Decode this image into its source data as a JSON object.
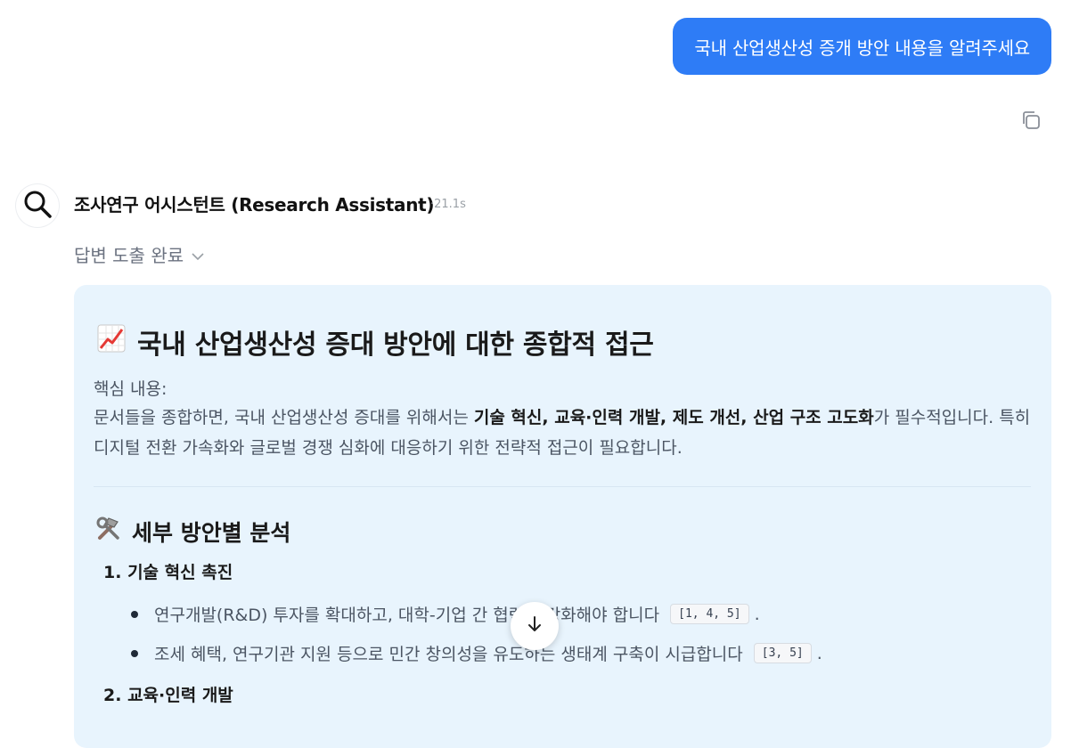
{
  "user_message": "국내 산업생산성 증개 방안 내용을 알려주세요",
  "assistant": {
    "name": "조사연구 어시스턴트 (Research Assistant)",
    "elapsed": "·21.1s",
    "status": "답변 도출 완료",
    "status_chevron": "chevron-down-icon"
  },
  "answer": {
    "title": "국내 산업생산성 증대 방안에 대한 종합적 접근",
    "title_icon": "chart-increasing-icon",
    "summary_label": "핵심 내용:",
    "summary_lines": {
      "pre": "문서들을 종합하면, 국내 산업생산성 증대를 위해서는 ",
      "bold": "기술 혁신, 교육·인력 개발, 제도 개선, 산업 구조 고도화",
      "post": "가 필수적입니다. 특히 디지털 전환 가속화와 글로벌 경쟁 심화에 대응하기 위한 전략적 접근이 필요합니다."
    },
    "section_title": "세부 방안별 분석",
    "section_icon": "hammer-wrench-icon",
    "items": [
      {
        "number": "1.",
        "label": "기술 혁신 촉진",
        "bullets": [
          {
            "text": "연구개발(R&D) 투자를 확대하고, 대학-기업 간 협력을 강화해야 합니다",
            "cite": "[1, 4, 5]",
            "end": "."
          },
          {
            "text": "조세 혜택, 연구기관 지원 등으로 민간 창의성을 유도하는 생태계 구축이 시급합니다",
            "cite": "[3, 5]",
            "end": "."
          }
        ]
      },
      {
        "number": "2.",
        "label": "교육·인력 개발",
        "bullets": []
      }
    ]
  },
  "colors": {
    "accent": "#2e7cf6",
    "card_bg": "#e8f4fd"
  }
}
